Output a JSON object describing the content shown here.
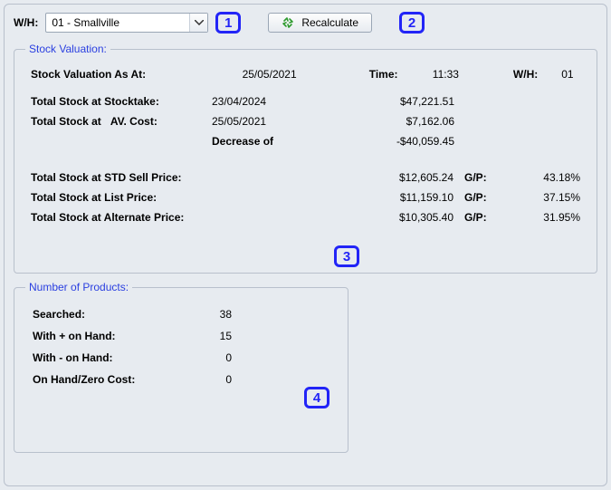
{
  "header": {
    "wh_label": "W/H:",
    "wh_value": "01 - Smallville",
    "recalc_label": "Recalculate"
  },
  "callouts": {
    "c1": "1",
    "c2": "2",
    "c3": "3",
    "c4": "4"
  },
  "stock_valuation": {
    "legend": "Stock Valuation:",
    "as_at_label": "Stock Valuation As At:",
    "as_at_value": "25/05/2021",
    "time_label": "Time:",
    "time_value": "11:33",
    "wh_label": "W/H:",
    "wh_value": "01",
    "stocktake_label": "Total Stock at Stocktake:",
    "stocktake_date": "23/04/2024",
    "stocktake_amount": "$47,221.51",
    "avcost_prefix": "Total Stock at",
    "avcost_suffix": "AV. Cost:",
    "avcost_date": "25/05/2021",
    "avcost_amount": "$7,162.06",
    "decrease_label": "Decrease of",
    "decrease_amount": "-$40,059.45",
    "std_label": "Total Stock at STD Sell Price:",
    "std_amount": "$12,605.24",
    "list_label": "Total Stock at List Price:",
    "list_amount": "$11,159.10",
    "alt_label": "Total Stock at Alternate Price:",
    "alt_amount": "$10,305.40",
    "gp_label": "G/P:",
    "std_pct": "43.18%",
    "list_pct": "37.15%",
    "alt_pct": "31.95%"
  },
  "products": {
    "legend": "Number of Products:",
    "searched_label": "Searched:",
    "searched_value": "38",
    "plus_label": "With + on Hand:",
    "plus_value": "15",
    "minus_label": "With - on Hand:",
    "minus_value": "0",
    "zero_label": "On Hand/Zero Cost:",
    "zero_value": "0"
  }
}
